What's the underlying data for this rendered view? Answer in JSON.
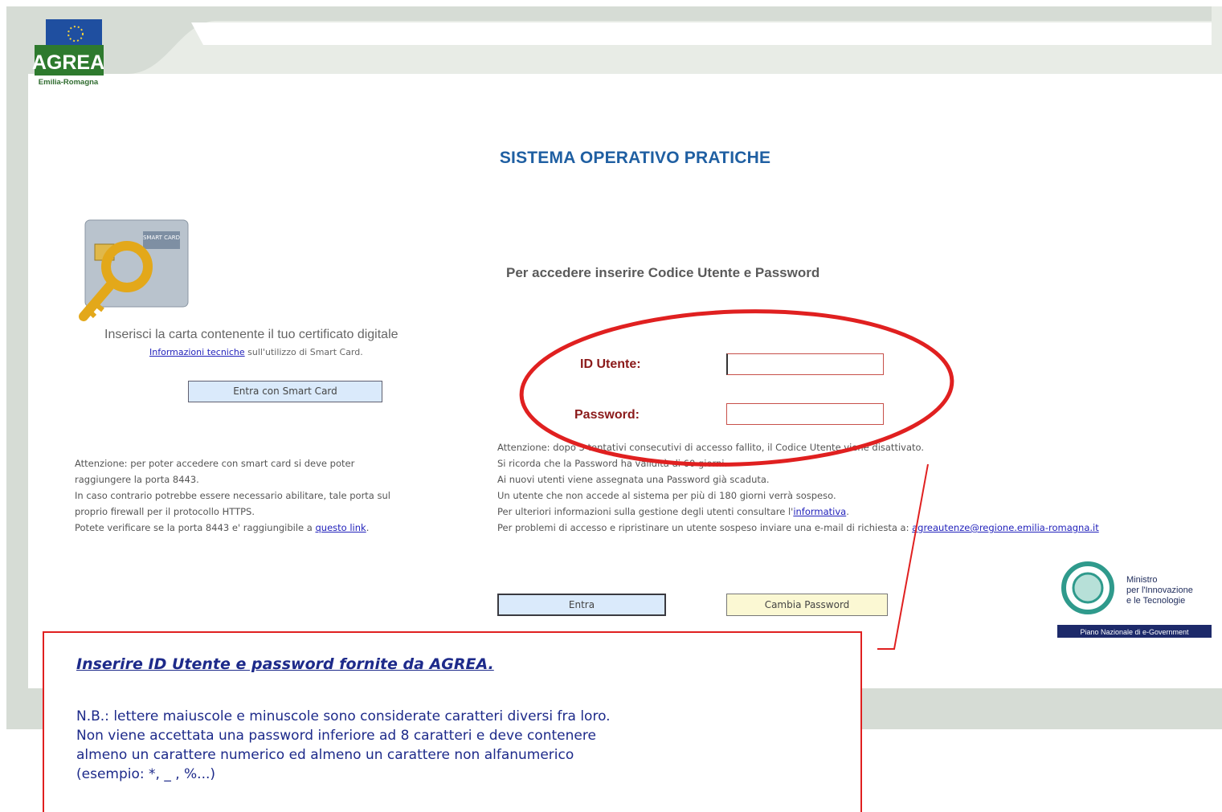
{
  "header": {
    "logo_text": "AGREA",
    "logo_subtext": "Emilia-Romagna",
    "title": "SISTEMA OPERATIVO PRATICHE"
  },
  "smartcard": {
    "card_label": "SMART CARD",
    "prompt": "Inserisci la carta contenente il tuo certificato digitale",
    "info_link": "Informazioni tecniche",
    "info_rest": " sull'utilizzo di Smart Card.",
    "button": "Entra con Smart Card",
    "warning_lines": [
      "Attenzione: per poter accedere con smart card si deve poter",
      "raggiungere la porta 8443.",
      "In caso contrario potrebbe essere necessario abilitare, tale porta sul",
      "proprio firewall per il protocollo HTTPS."
    ],
    "verify_text": "Potete verificare se la porta 8443 e' raggiungibile a ",
    "verify_link": "questo link",
    "verify_end": "."
  },
  "login": {
    "heading": "Per accedere inserire Codice Utente e Password",
    "user_label": "ID Utente:",
    "user_value": "",
    "password_label": "Password:",
    "password_value": "",
    "notes": [
      "Attenzione: dopo 3 tentativi consecutivi di accesso fallito, il Codice Utente viene disattivato.",
      "Si ricorda che la Password ha validità di 60 giorni.",
      "Ai nuovi utenti viene assegnata una Password già scaduta.",
      "Un utente che non accede al sistema per più di 180 giorni verrà sospeso."
    ],
    "info_text": "Per ulteriori informazioni sulla gestione degli utenti consultare l'",
    "info_link": "informativa",
    "info_end": ".",
    "problem_text": "Per problemi di accesso e ripristinare un utente sospeso inviare una e-mail di richiesta a: ",
    "problem_email": "agreautenze@regione.emilia-romagna.it",
    "enter_button": "Entra",
    "change_password_button": "Cambia Password"
  },
  "ministry": {
    "name_line1": "Ministro",
    "name_line2": "per l'Innovazione",
    "name_line3": "e le Tecnologie",
    "banner": "Piano Nazionale di e-Government"
  },
  "callout": {
    "title": "Inserire ID Utente e password fornite da AGREA.",
    "body_lines": [
      "N.B.: lettere maiuscole e minuscole sono considerate caratteri diversi fra loro.",
      "Non viene accettata una password inferiore ad 8 caratteri e deve contenere",
      "almeno un carattere numerico ed almeno un carattere non alfanumerico",
      "(esempio: *, _ , %...)"
    ]
  },
  "colors": {
    "title_blue": "#1f5fa2",
    "label_red": "#8b1a1a",
    "annotation_red": "#e02020",
    "callout_text": "#1d2a8a",
    "frame_gray": "#d6dcd5"
  }
}
